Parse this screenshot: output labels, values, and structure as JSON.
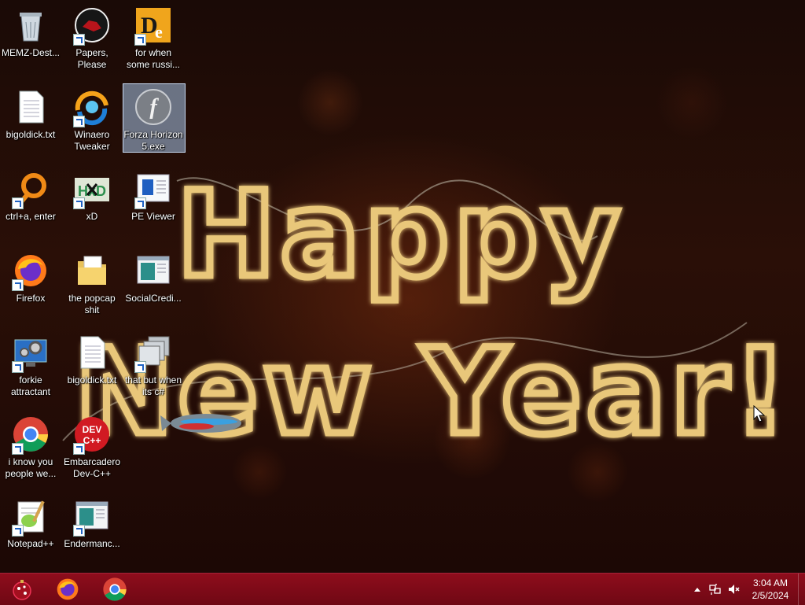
{
  "desktop": {
    "icons": [
      {
        "name": "recycle-bin-icon",
        "label": "MEMZ-Dest...",
        "shortcut": false
      },
      {
        "name": "papers-please-icon",
        "label": "Papers, Please",
        "shortcut": true
      },
      {
        "name": "die-app-icon",
        "label": "for when\nsome russi...",
        "shortcut": true
      },
      {
        "name": "text-file-icon",
        "label": "bigoldick.txt",
        "shortcut": false
      },
      {
        "name": "winaero-tweaker-icon",
        "label": "Winaero\nTweaker",
        "shortcut": true
      },
      {
        "name": "flash-exe-icon",
        "label": "Forza Horizon\n5.exe",
        "shortcut": false,
        "selected": true
      },
      {
        "name": "ring-app-icon",
        "label": "ctrl+a, enter",
        "shortcut": true
      },
      {
        "name": "hxd-icon",
        "label": "xD",
        "shortcut": true
      },
      {
        "name": "pe-viewer-icon",
        "label": "PE Viewer",
        "shortcut": true
      },
      {
        "name": "firefox-icon",
        "label": "Firefox",
        "shortcut": true
      },
      {
        "name": "folder-icon",
        "label": "the popcap\nshit",
        "shortcut": false
      },
      {
        "name": "app-window-icon",
        "label": "SocialCredi...",
        "shortcut": false
      },
      {
        "name": "gear-monitor-icon",
        "label": "forkie\nattractant",
        "shortcut": true
      },
      {
        "name": "text-file-icon",
        "label": "bigoldick.txt",
        "shortcut": false
      },
      {
        "name": "stacked-windows-icon",
        "label": "that but when\nits c#",
        "shortcut": true
      },
      {
        "name": "chrome-icon",
        "label": "i know you\npeople we...",
        "shortcut": true
      },
      {
        "name": "devcpp-icon",
        "label": "Embarcadero\nDev-C++",
        "shortcut": true
      },
      {
        "name": "notepadpp-icon",
        "label": "Notepad++",
        "shortcut": true
      },
      {
        "name": "app-window-icon",
        "label": "Endermanc...",
        "shortcut": true
      }
    ],
    "devcpp_badge": "DEV\nC++",
    "hxd_badge": "HxD",
    "wallpaper_text": [
      "Happy",
      "New Year!"
    ]
  },
  "taskbar": {
    "pinned": [
      "start-button-icon",
      "firefox-icon",
      "chrome-icon"
    ],
    "tray": {
      "chevron": "show-hidden-icons",
      "time": "3:04 AM",
      "date": "2/5/2024"
    }
  },
  "colors": {
    "taskbar": "#8e0d1c",
    "selection": "#aac8eb",
    "lights": "#f6d98a"
  }
}
